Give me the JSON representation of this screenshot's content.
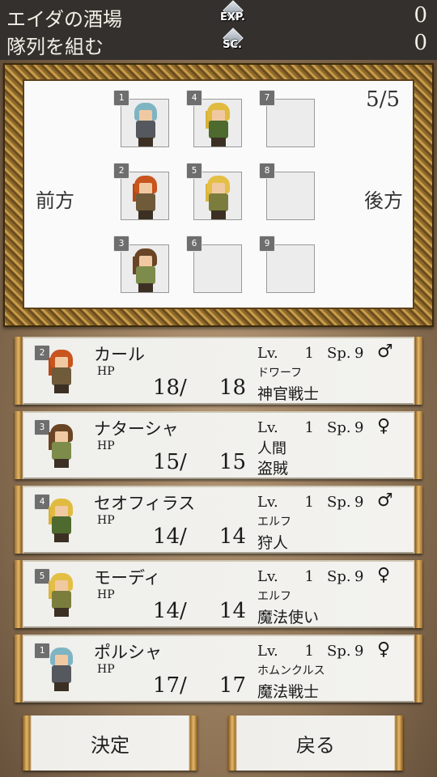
{
  "header": {
    "title": "エイダの酒場",
    "subtitle": "隊列を組む",
    "exp_label": "EXP.",
    "exp_value": "0",
    "sc_label": "SC.",
    "sc_value": "0"
  },
  "formation": {
    "count": "5/5",
    "front_label": "前方",
    "back_label": "後方",
    "slots": [
      {
        "num": "1",
        "occupant": "ポルシャ"
      },
      {
        "num": "2",
        "occupant": "カール"
      },
      {
        "num": "3",
        "occupant": "ナターシャ"
      },
      {
        "num": "4",
        "occupant": "セオフィラス"
      },
      {
        "num": "5",
        "occupant": "モーディ"
      },
      {
        "num": "6",
        "occupant": ""
      },
      {
        "num": "7",
        "occupant": ""
      },
      {
        "num": "8",
        "occupant": ""
      },
      {
        "num": "9",
        "occupant": ""
      }
    ]
  },
  "roster": [
    {
      "slot": "2",
      "name": "カール",
      "hp_label": "HP",
      "hp_cur": "18",
      "slash": "/",
      "hp_max": "18",
      "lv_label": "Lv.",
      "lv": "1",
      "sp_label": "Sp.",
      "sp": "9",
      "gender": "♂",
      "race": "ドワーフ",
      "class": "神官戦士"
    },
    {
      "slot": "3",
      "name": "ナターシャ",
      "hp_label": "HP",
      "hp_cur": "15",
      "slash": "/",
      "hp_max": "15",
      "lv_label": "Lv.",
      "lv": "1",
      "sp_label": "Sp.",
      "sp": "9",
      "gender": "♀",
      "race": "人間",
      "class": "盗賊"
    },
    {
      "slot": "4",
      "name": "セオフィラス",
      "hp_label": "HP",
      "hp_cur": "14",
      "slash": "/",
      "hp_max": "14",
      "lv_label": "Lv.",
      "lv": "1",
      "sp_label": "Sp.",
      "sp": "9",
      "gender": "♂",
      "race": "エルフ",
      "class": "狩人"
    },
    {
      "slot": "5",
      "name": "モーディ",
      "hp_label": "HP",
      "hp_cur": "14",
      "slash": "/",
      "hp_max": "14",
      "lv_label": "Lv.",
      "lv": "1",
      "sp_label": "Sp.",
      "sp": "9",
      "gender": "♀",
      "race": "エルフ",
      "class": "魔法使い"
    },
    {
      "slot": "1",
      "name": "ポルシャ",
      "hp_label": "HP",
      "hp_cur": "17",
      "slash": "/",
      "hp_max": "17",
      "lv_label": "Lv.",
      "lv": "1",
      "sp_label": "Sp.",
      "sp": "9",
      "gender": "♀",
      "race": "ホムンクルス",
      "class": "魔法戦士"
    }
  ],
  "buttons": {
    "confirm": "決定",
    "back": "戻る"
  },
  "colors": {
    "header_bg": "#33302d",
    "frame_gold": "#c69a48",
    "card_bg": "#f3f2ee"
  }
}
